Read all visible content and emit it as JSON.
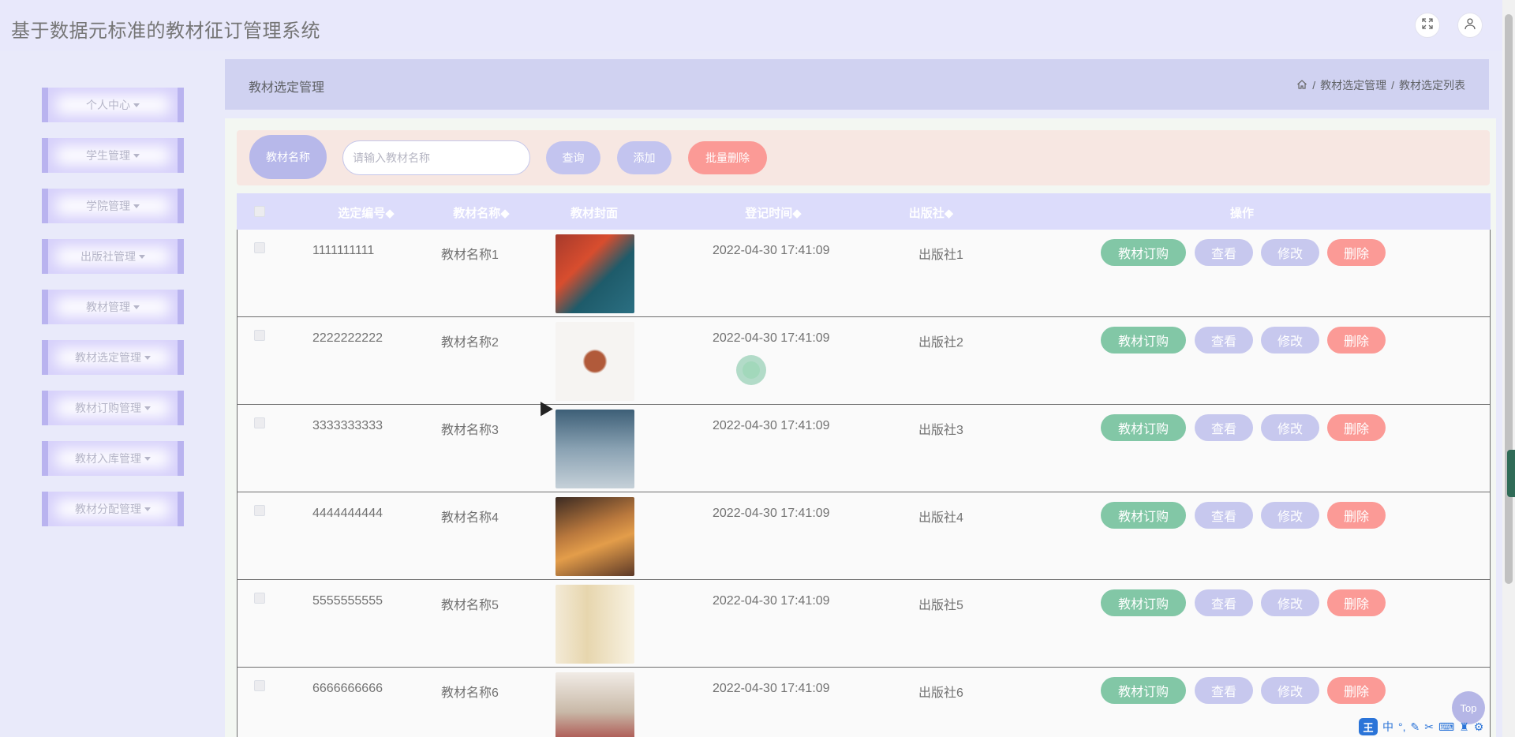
{
  "app": {
    "title": "基于数据元标准的教材征订管理系统"
  },
  "topbar": {
    "fullscreen_icon": "fullscreen-icon",
    "user_icon": "user-icon"
  },
  "sidebar": {
    "items": [
      {
        "label": "个人中心"
      },
      {
        "label": "学生管理"
      },
      {
        "label": "学院管理"
      },
      {
        "label": "出版社管理"
      },
      {
        "label": "教材管理"
      },
      {
        "label": "教材选定管理"
      },
      {
        "label": "教材订购管理"
      },
      {
        "label": "教材入库管理"
      },
      {
        "label": "教材分配管理"
      }
    ]
  },
  "header": {
    "section_title": "教材选定管理",
    "breadcrumb": [
      "教材选定管理",
      "教材选定列表"
    ]
  },
  "search": {
    "label": "教材名称",
    "placeholder": "请输入教材名称",
    "query_btn": "查询",
    "add_btn": "添加",
    "batch_delete_btn": "批量删除"
  },
  "table": {
    "headers": {
      "code": "选定编号",
      "name": "教材名称",
      "cover": "教材封面",
      "time": "登记时间",
      "publisher": "出版社",
      "ops": "操作"
    },
    "actions": {
      "order": "教材订购",
      "view": "查看",
      "edit": "修改",
      "delete": "删除"
    },
    "rows": [
      {
        "code": "1111111111",
        "name": "教材名称1",
        "time": "2022-04-30 17:41:09",
        "publisher": "出版社1"
      },
      {
        "code": "2222222222",
        "name": "教材名称2",
        "time": "2022-04-30 17:41:09",
        "publisher": "出版社2"
      },
      {
        "code": "3333333333",
        "name": "教材名称3",
        "time": "2022-04-30 17:41:09",
        "publisher": "出版社3"
      },
      {
        "code": "4444444444",
        "name": "教材名称4",
        "time": "2022-04-30 17:41:09",
        "publisher": "出版社4"
      },
      {
        "code": "5555555555",
        "name": "教材名称5",
        "time": "2022-04-30 17:41:09",
        "publisher": "出版社5"
      },
      {
        "code": "6666666666",
        "name": "教材名称6",
        "time": "2022-04-30 17:41:09",
        "publisher": "出版社6"
      }
    ]
  },
  "back_to_top": "Top",
  "ime": {
    "logo": "王",
    "lang": "中",
    "punct": "°,"
  }
}
